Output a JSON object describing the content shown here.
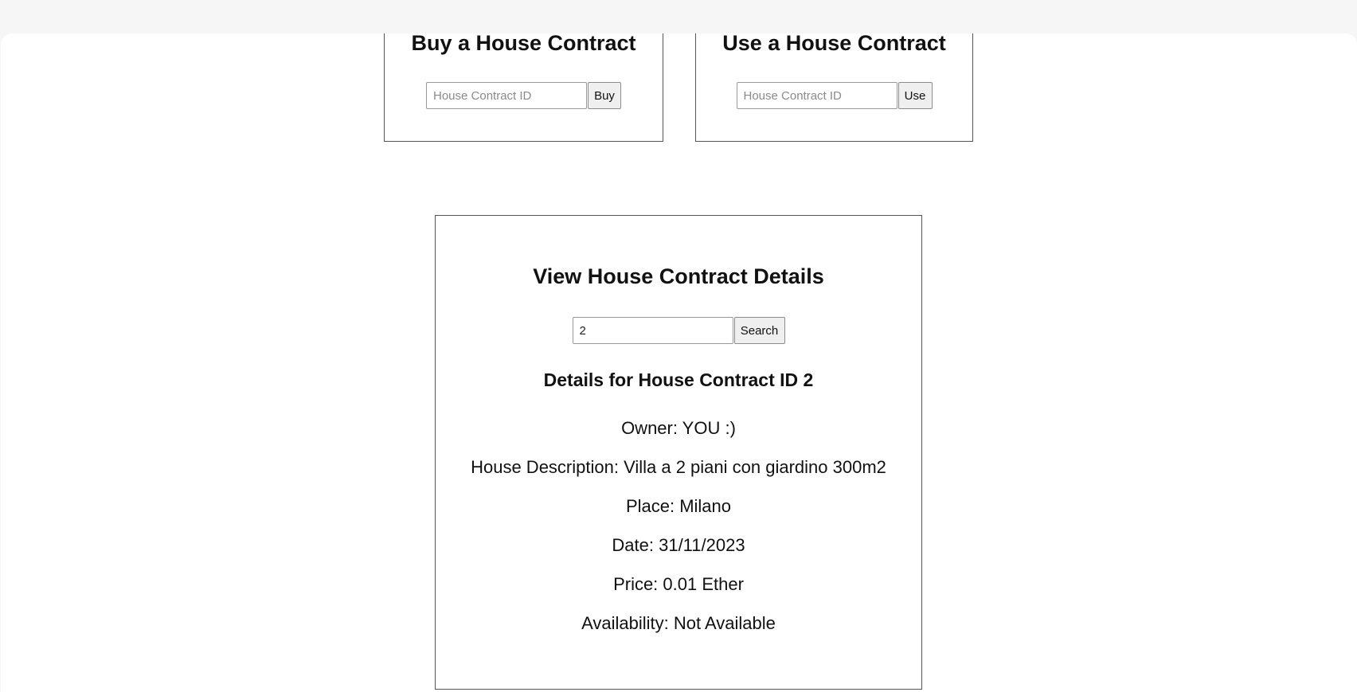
{
  "buy_card": {
    "title": "Buy a House Contract",
    "input_placeholder": "House Contract ID",
    "button_label": "Buy"
  },
  "use_card": {
    "title": "Use a House Contract",
    "input_placeholder": "House Contract ID",
    "button_label": "Use"
  },
  "view_card": {
    "title": "View House Contract Details",
    "search_value": "2",
    "button_label": "Search",
    "details_title": "Details for House Contract ID 2",
    "owner": "Owner: YOU :)",
    "description": "House Description: Villa a 2 piani con giardino 300m2",
    "place": "Place: Milano",
    "date": "Date: 31/11/2023",
    "price": "Price: 0.01 Ether",
    "availability": "Availability: Not Available"
  }
}
